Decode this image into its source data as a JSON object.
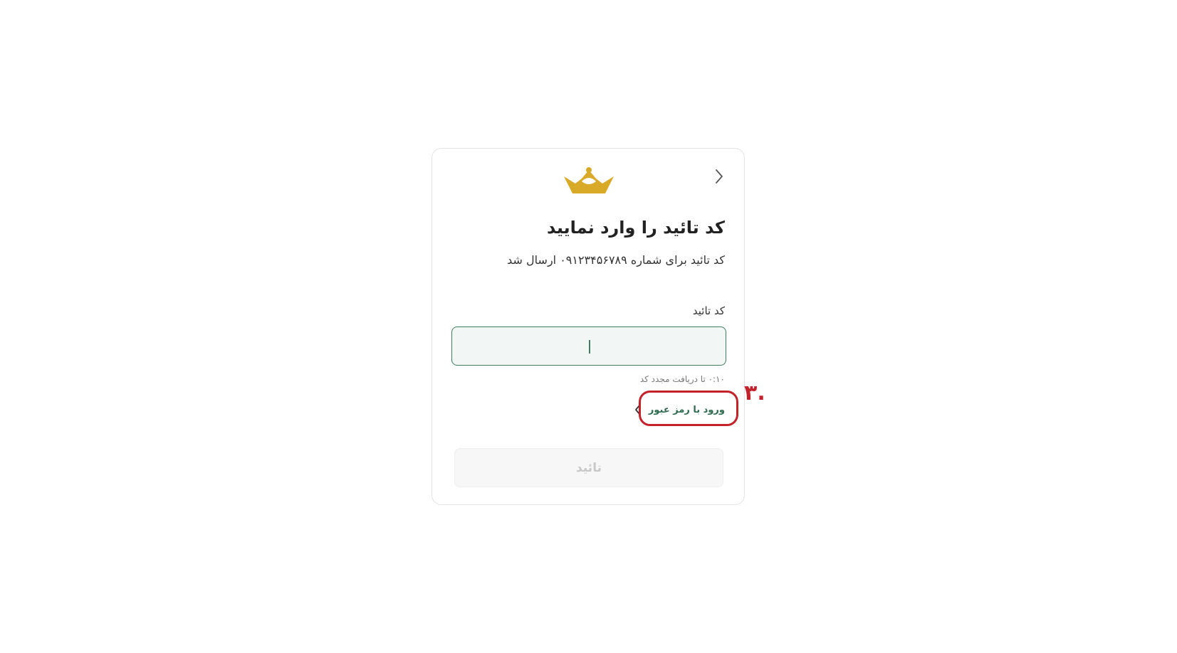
{
  "header": {
    "back_icon": "chevron-right-icon",
    "logo_icon": "crown-icon"
  },
  "content": {
    "title": "کد تائید را وارد نمایید",
    "subtitle": "کد تائید برای شماره ۰۹۱۲۳۴۵۶۷۸۹ ارسال شد",
    "field_label": "کد تائید",
    "input_value": "",
    "input_placeholder": "",
    "resend_text": "۰:۱۰ تا دریافت مجدد کد",
    "password_login_label": "ورود با رمز عبور",
    "password_login_icon": "chevron-left-icon",
    "confirm_label": "تائید"
  },
  "annotation": {
    "step_number": ".۳",
    "color": "#c4222a"
  },
  "colors": {
    "accent": "#3f7d5e",
    "logo": "#d9a928",
    "disabled_text": "#c8c8c8"
  }
}
